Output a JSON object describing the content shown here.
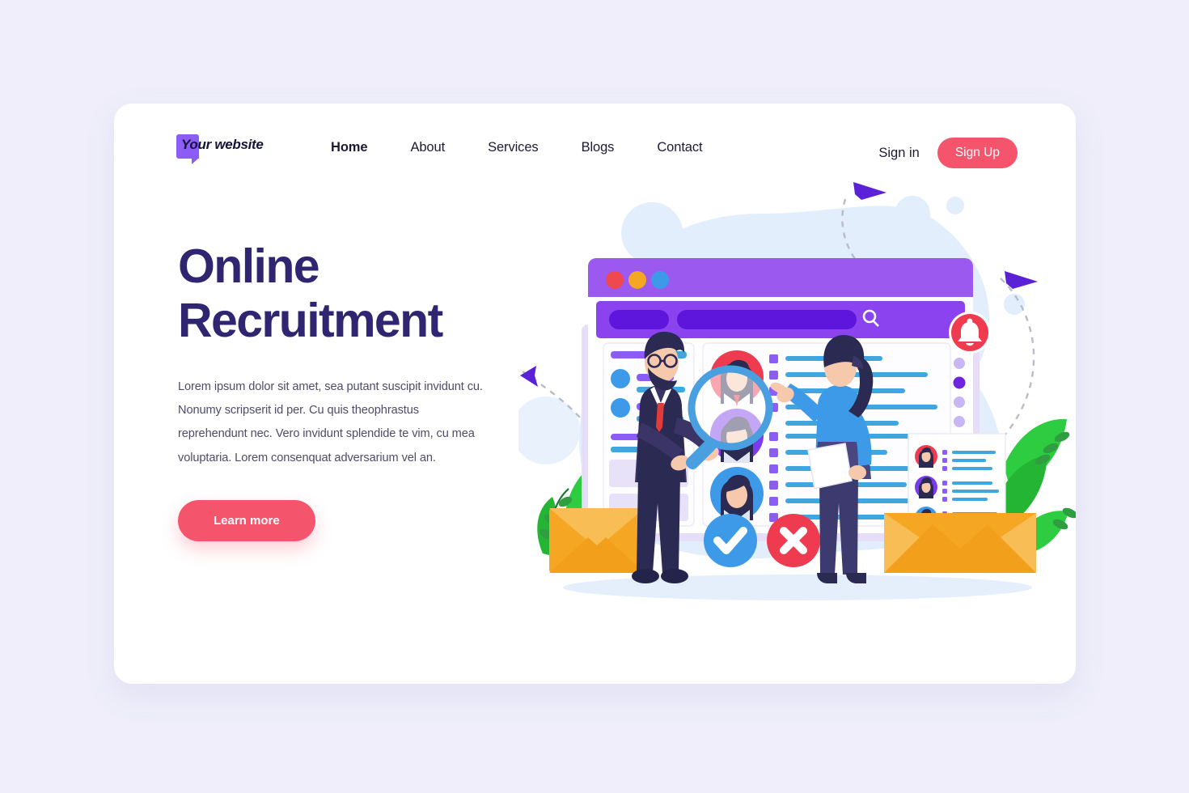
{
  "brand": {
    "name": "Your website"
  },
  "nav": {
    "items": [
      {
        "label": "Home",
        "active": true
      },
      {
        "label": "About",
        "active": false
      },
      {
        "label": "Services",
        "active": false
      },
      {
        "label": "Blogs",
        "active": false
      },
      {
        "label": "Contact",
        "active": false
      }
    ],
    "signin_label": "Sign in",
    "signup_label": "Sign Up"
  },
  "hero": {
    "title_line1": "Online",
    "title_line2": "Recruitment",
    "body": "Lorem ipsum dolor sit amet, sea putant suscipit invidunt cu. Nonumy scripserit id per. Cu quis theophrastus reprehendunt nec. Vero invidunt splendide te vim, cu mea voluptaria. Lorem consenquat adversarium vel an.",
    "cta_label": "Learn more"
  },
  "illustration": {
    "description": "Online recruitment scene: browser window with candidate list, man with magnifying glass, woman pointing at results, envelopes with resumes",
    "browser": {
      "traffic_lights": [
        "red",
        "orange",
        "blue"
      ],
      "search_icon": "magnifier-icon",
      "notification_icon": "bell-icon"
    },
    "actions": {
      "accept_icon": "check-icon",
      "reject_icon": "cross-icon"
    }
  },
  "colors": {
    "page_bg": "#efeefa",
    "card_bg": "#ffffff",
    "heading": "#2f2570",
    "body_text": "#4e4c69",
    "accent_pink": "#f4556c",
    "logo_purple": "#8b5cf6",
    "browser_purple": "#9b59f0",
    "browser_bar_deep": "#6f24e0",
    "blob_blue": "#e2eefb",
    "envelope_orange": "#f5a623",
    "leaf_green": "#2ecc40",
    "avatar_red": "#ef3b4f",
    "avatar_purple": "#7c3aed",
    "avatar_blue": "#3d9ae8",
    "text_line_blue": "#3fa6e0",
    "navy": "#2b2a52"
  }
}
